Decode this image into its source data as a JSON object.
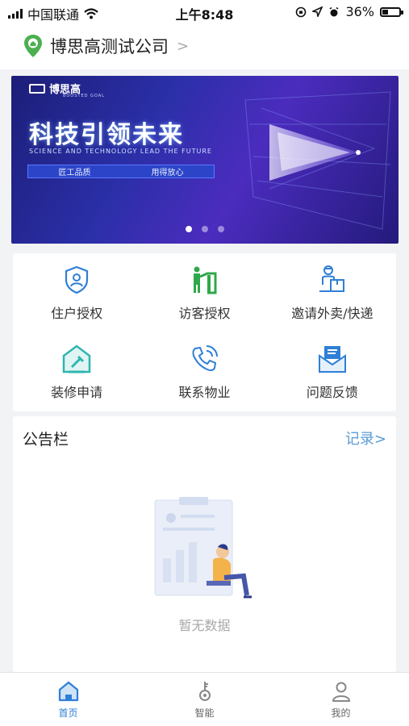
{
  "status_bar": {
    "carrier": "中国联通",
    "time": "上午8:48",
    "battery": "36%",
    "battery_level": 0.36
  },
  "header": {
    "company": "博思高测试公司",
    "chevron": ">",
    "location_icon": "location-pin-icon"
  },
  "banner": {
    "logo_text": "博思高",
    "logo_sub": "BOOSTED GOAL",
    "title": "科技引领未来",
    "subtitle": "SCIENCE AND TECHNOLOGY LEAD THE FUTURE",
    "tagline_left": "匠工品质",
    "tagline_right": "用得放心",
    "active_slide": 1,
    "slide_count": 3
  },
  "services": [
    {
      "label": "住户授权",
      "icon": "resident-shield-icon",
      "color": "#2f7fd6"
    },
    {
      "label": "访客授权",
      "icon": "visitor-icon",
      "color": "#2ea84a"
    },
    {
      "label": "邀请外卖/快递",
      "icon": "delivery-icon",
      "color": "#2f7fd6"
    },
    {
      "label": "装修申请",
      "icon": "renovation-house-icon",
      "color": "#2fb5b0"
    },
    {
      "label": "联系物业",
      "icon": "phone-icon",
      "color": "#2f7fd6"
    },
    {
      "label": "问题反馈",
      "icon": "feedback-envelope-icon",
      "color": "#2f7fd6"
    }
  ],
  "notice_board": {
    "title": "公告栏",
    "records_link": "记录>",
    "empty_text": "暂无数据"
  },
  "tabbar": {
    "items": [
      {
        "label": "首页",
        "icon": "home-icon",
        "active": true
      },
      {
        "label": "智能",
        "icon": "smart-key-icon",
        "active": false
      },
      {
        "label": "我的",
        "icon": "profile-icon",
        "active": false
      }
    ]
  },
  "colors": {
    "accent": "#2f7fd6",
    "link": "#5b9bd5",
    "banner_bg": "#2b2fa8"
  }
}
